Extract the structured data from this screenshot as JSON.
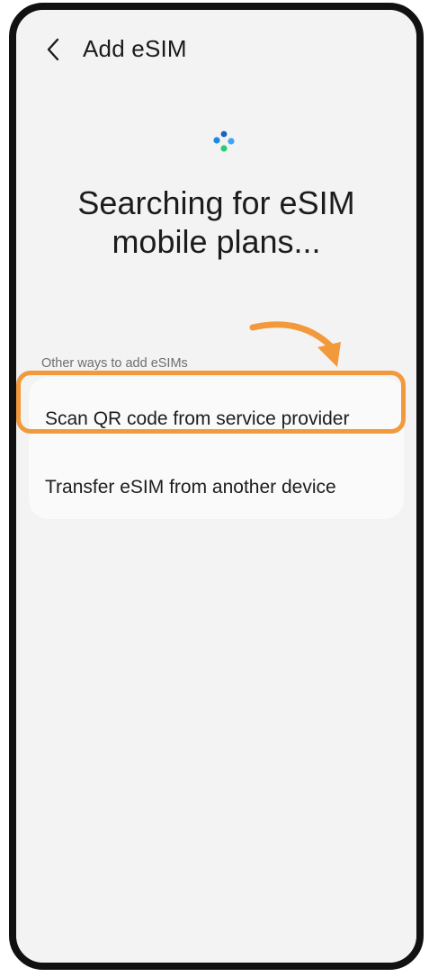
{
  "app_bar": {
    "back_icon": "chevron-left-icon",
    "title": "Add eSIM"
  },
  "loader": {
    "icon": "searching-dots-icon",
    "colors": [
      "#1e88e5",
      "#1565c0",
      "#42a5f5",
      "#2ecc71"
    ]
  },
  "headline": {
    "line1": "Searching for eSIM",
    "line2": "mobile plans..."
  },
  "other_ways": {
    "label": "Other ways to add eSIMs",
    "options": [
      {
        "label": "Scan QR code from service provider",
        "highlighted": true
      },
      {
        "label": "Transfer eSIM from another device",
        "highlighted": false
      }
    ]
  },
  "annotation": {
    "highlight_color": "#f29a3b",
    "arrow_icon": "curved-arrow-icon"
  }
}
